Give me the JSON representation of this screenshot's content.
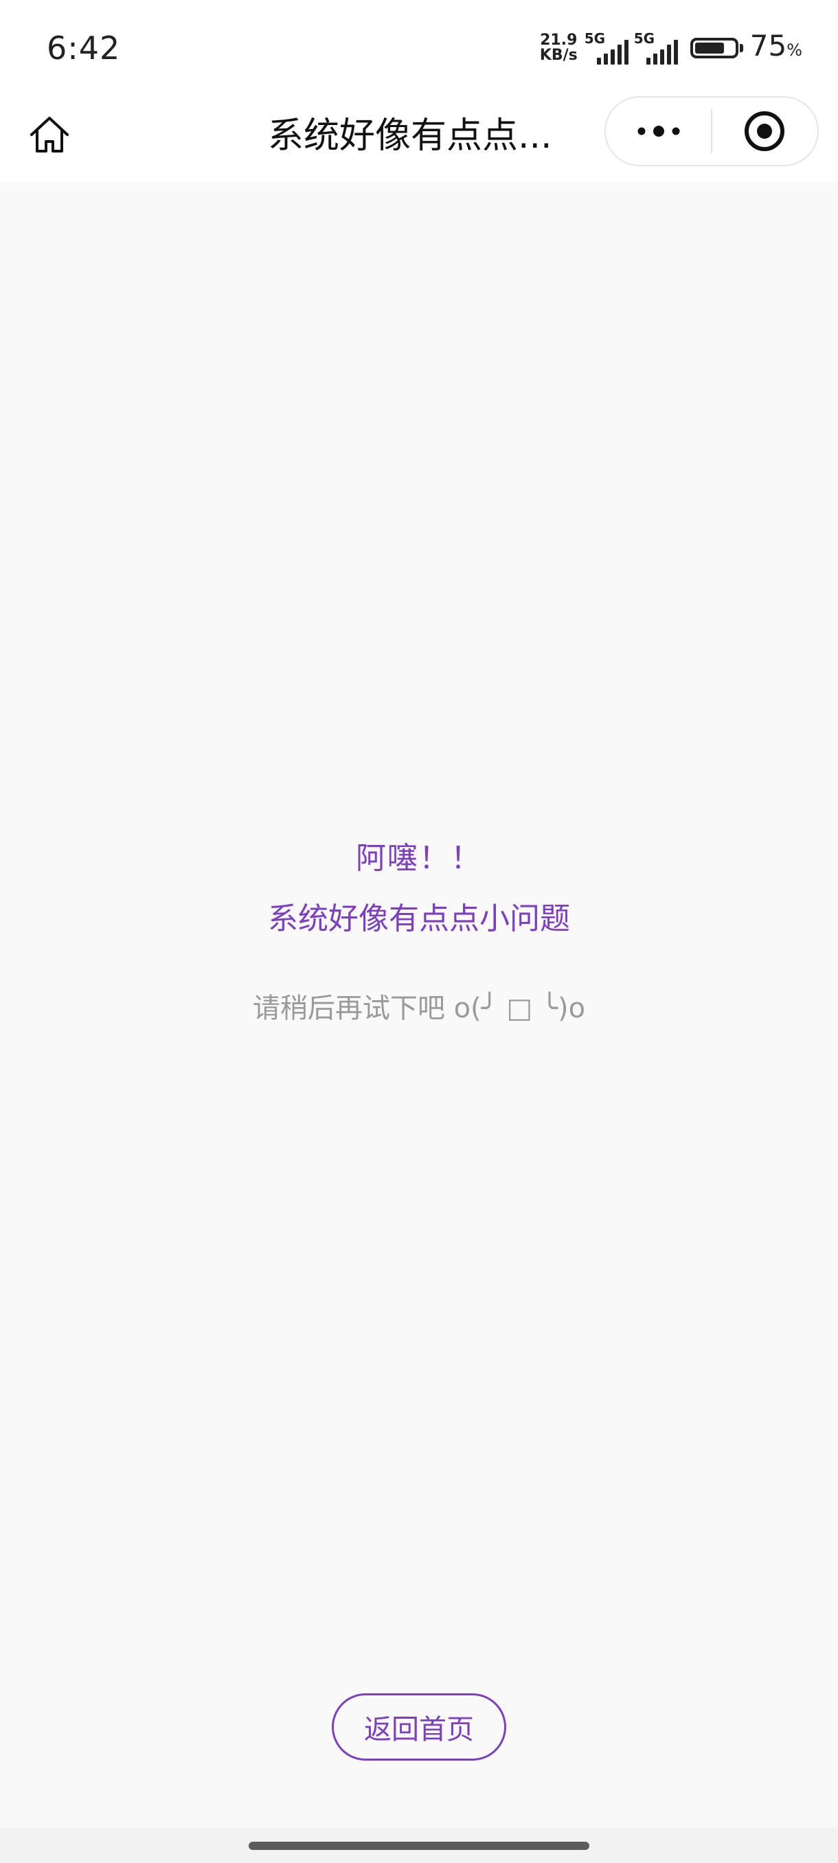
{
  "status_bar": {
    "time": "6:42",
    "net_speed_value": "21.9",
    "net_speed_unit": "KB/s",
    "sim1_tag": "5G",
    "sim2_tag": "5G",
    "battery_percent": "75",
    "battery_percent_sign": "%",
    "battery_level": 0.75
  },
  "nav": {
    "title": "系统好像有点点...",
    "home_icon": "home-icon",
    "more_icon": "more-dots-icon",
    "close_icon": "close-circle-icon"
  },
  "error": {
    "title": "阿噻！！",
    "subtitle": "系统好像有点点小问题",
    "hint": "请稍后再试下吧 o(╯ □ ╰)o"
  },
  "actions": {
    "back_home_label": "返回首页"
  },
  "colors": {
    "accent": "#7b3fbf",
    "hint_text": "#9a9a9a",
    "background": "#f9f9f9"
  }
}
